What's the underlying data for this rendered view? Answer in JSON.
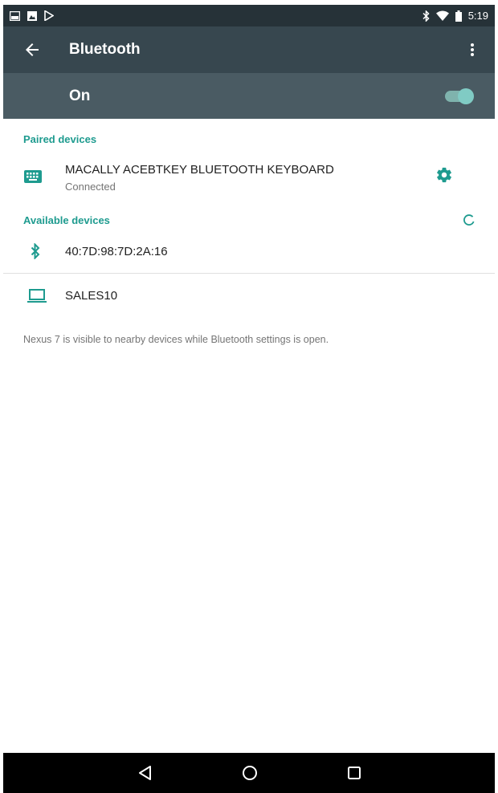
{
  "status_bar": {
    "left_icons": [
      "image-icon",
      "photo-icon",
      "play-store-icon"
    ],
    "right_icons": [
      "bluetooth-icon",
      "wifi-icon",
      "battery-icon"
    ],
    "time": "5:19"
  },
  "app_bar": {
    "back_icon": "arrow-back-icon",
    "title": "Bluetooth",
    "menu_icon": "more-vert-icon"
  },
  "master_switch": {
    "label": "On",
    "checked": true,
    "accent_color": "#80cbc4"
  },
  "paired": {
    "header": "Paired devices",
    "devices": [
      {
        "name": "MACALLY ACEBTKEY BLUETOOTH KEYBOARD",
        "status": "Connected",
        "icon": "keyboard-icon",
        "settings_icon": "gear-icon"
      }
    ]
  },
  "available": {
    "header": "Available devices",
    "refresh_icon": "refresh-icon",
    "devices": [
      {
        "name": "40:7D:98:7D:2A:16",
        "icon": "bluetooth-icon"
      },
      {
        "name": "SALES10",
        "icon": "laptop-icon"
      }
    ]
  },
  "footer": {
    "visibility_text": "Nexus 7 is visible to nearby devices while Bluetooth settings is open."
  },
  "nav_bar": {
    "buttons": [
      "back-triangle-icon",
      "home-circle-icon",
      "recents-square-icon"
    ]
  },
  "colors": {
    "accent": "#1e9b8f",
    "status_bar": "#263238",
    "app_bar": "#37474f",
    "switch_bar": "#4a5b63"
  }
}
